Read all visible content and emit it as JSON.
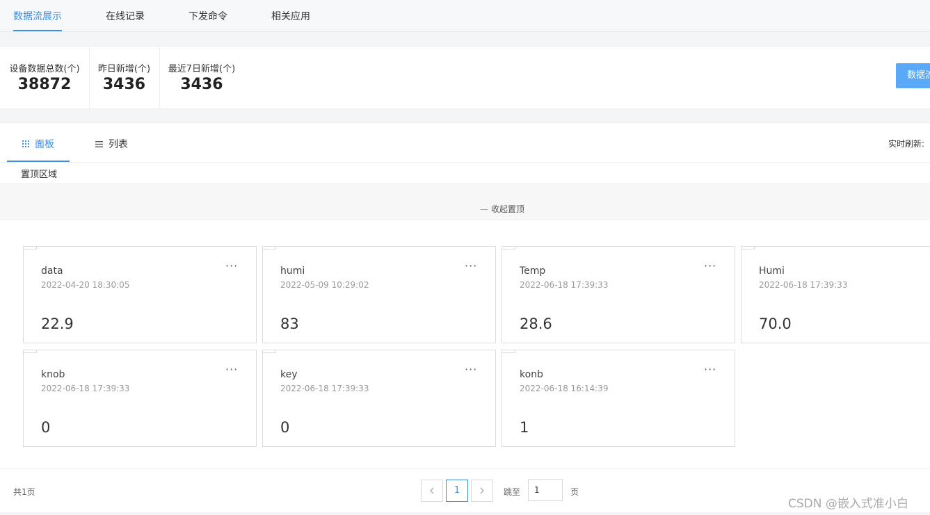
{
  "tabs": [
    {
      "label": "数据流展示",
      "active": true
    },
    {
      "label": "在线记录",
      "active": false
    },
    {
      "label": "下发命令",
      "active": false
    },
    {
      "label": "相关应用",
      "active": false
    }
  ],
  "stats": [
    {
      "label": "设备数据总数(个)",
      "value": "38872"
    },
    {
      "label": "昨日新增(个)",
      "value": "3436"
    },
    {
      "label": "最近7日新增(个)",
      "value": "3436"
    }
  ],
  "primary_button": {
    "label": "数据流"
  },
  "view_tabs": [
    {
      "label": "面板",
      "icon": "grid-icon",
      "active": true
    },
    {
      "label": "列表",
      "icon": "list-icon",
      "active": false
    }
  ],
  "realtime_refresh_label": "实时刷新:",
  "pinned": {
    "title": "置顶区域",
    "collapse_label": "收起置顶"
  },
  "cards": [
    {
      "name": "data",
      "time": "2022-04-20 18:30:05",
      "value": "22.9"
    },
    {
      "name": "humi",
      "time": "2022-05-09 10:29:02",
      "value": "83"
    },
    {
      "name": "Temp",
      "time": "2022-06-18 17:39:33",
      "value": "28.6"
    },
    {
      "name": "Humi",
      "time": "2022-06-18 17:39:33",
      "value": "70.0"
    },
    {
      "name": "knob",
      "time": "2022-06-18 17:39:33",
      "value": "0"
    },
    {
      "name": "key",
      "time": "2022-06-18 17:39:33",
      "value": "0"
    },
    {
      "name": "konb",
      "time": "2022-06-18 16:14:39",
      "value": "1"
    }
  ],
  "card_menu": "···",
  "pagination": {
    "total_label": "共1页",
    "current_page": "1",
    "goto_label": "跳至",
    "goto_value": "1",
    "page_suffix": "页",
    "prev_icon": "chevron-left-icon",
    "next_icon": "chevron-right-icon"
  },
  "watermark": "CSDN @嵌入式准小白",
  "colors": {
    "accent": "#3a8ee6",
    "primary_button": "#5aa9f8"
  }
}
